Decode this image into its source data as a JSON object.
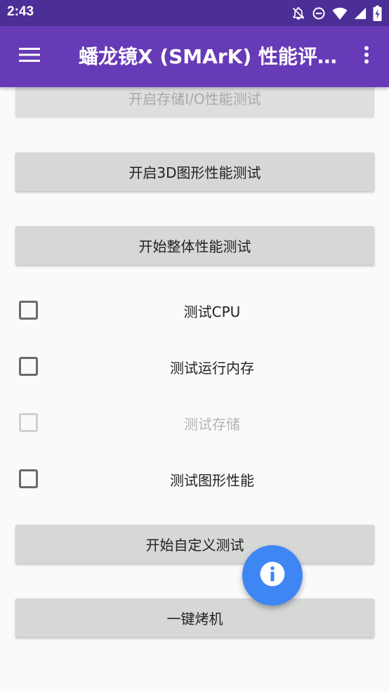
{
  "status_bar": {
    "time": "2:43",
    "icons": [
      "notifications-off-icon",
      "do-not-disturb-icon",
      "wifi-icon",
      "signal-icon",
      "battery-charging-icon"
    ]
  },
  "app_bar": {
    "title": "蟠龙镜X (SMArK) 性能评…",
    "menu_icon": "hamburger-menu-icon",
    "overflow_icon": "more-vert-icon",
    "color": "#673AB7",
    "status_color": "#4B2F96"
  },
  "buttons": {
    "storage_io": "开启存储I/O性能测试",
    "graphics_3d": "开启3D图形性能测试",
    "overall": "开始整体性能测试",
    "custom": "开始自定义测试",
    "burn_in": "一键烤机"
  },
  "checkboxes": [
    {
      "label": "测试CPU",
      "checked": false,
      "enabled": true
    },
    {
      "label": "测试运行内存",
      "checked": false,
      "enabled": true
    },
    {
      "label": "测试存储",
      "checked": false,
      "enabled": false
    },
    {
      "label": "测试图形性能",
      "checked": false,
      "enabled": true
    }
  ],
  "fab": {
    "icon": "info-icon",
    "color": "#3F86F5"
  }
}
